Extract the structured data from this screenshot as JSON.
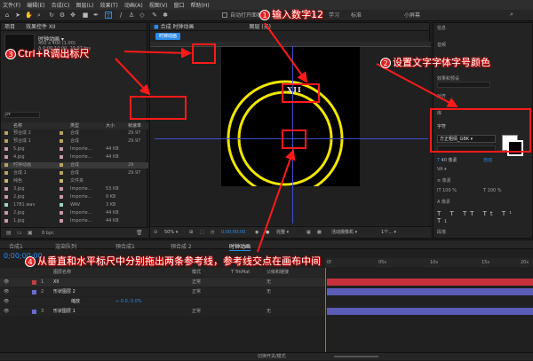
{
  "menu": [
    "文件(F)",
    "编辑(E)",
    "合成(C)",
    "图层(L)",
    "效果(T)",
    "动画(A)",
    "视图(V)",
    "窗口",
    "帮助(H)"
  ],
  "toolbar": {
    "auto_open_panel": "自动打开面板",
    "default": "默认",
    "learn": "学习",
    "standard": "标准",
    "small_screen": "小屏幕"
  },
  "project": {
    "tab_label": "项目",
    "tab_effects": "效果控件 XII",
    "comp_name": "时钟动画 ▾",
    "comp_size": "400 x 400 (1.00)",
    "comp_duration": "Δ 0;00;10;00, 29.97 fps",
    "search_placeholder": "ρ▾",
    "headers": {
      "name": "名称",
      "type": "类型",
      "size": "大小",
      "fps": "帧速率"
    },
    "rows": [
      {
        "name": "预合成 2",
        "type": "合成",
        "size": "",
        "fps": "29.97",
        "color": "#b9a35b"
      },
      {
        "name": "预合成 1",
        "type": "合成",
        "size": "",
        "fps": "29.97",
        "color": "#b9a35b"
      },
      {
        "name": "5.jpg",
        "type": "Importe...",
        "size": "44 KB",
        "fps": "",
        "color": "#c79aa5"
      },
      {
        "name": "4.jpg",
        "type": "Importe...",
        "size": "44 KB",
        "fps": "",
        "color": "#c79aa5"
      },
      {
        "name": "时钟动画",
        "type": "合成",
        "size": "",
        "fps": "29",
        "color": "#b9a35b"
      },
      {
        "name": "合成 1",
        "type": "合成",
        "size": "",
        "fps": "29.97",
        "color": "#b9a35b"
      },
      {
        "name": "纯色",
        "type": "文件夹",
        "size": "",
        "fps": "",
        "color": "#c9b46a"
      },
      {
        "name": "3.jpg",
        "type": "Importe...",
        "size": "53 KB",
        "fps": "",
        "color": "#c79aa5"
      },
      {
        "name": "2.jpg",
        "type": "Importe...",
        "size": "9 KB",
        "fps": "",
        "color": "#c79aa5"
      },
      {
        "name": "1781.wav",
        "type": "WAV",
        "size": "3 KB",
        "fps": "",
        "color": "#9fd3c7"
      },
      {
        "name": "2.jpg",
        "type": "Importe...",
        "size": "44 KB",
        "fps": "",
        "color": "#c79aa5"
      },
      {
        "name": "1.jpg",
        "type": "Importe...",
        "size": "44 KB",
        "fps": "",
        "color": "#c79aa5"
      }
    ],
    "bpc": "8 bpc"
  },
  "comp": {
    "tab_label": "合成 时钟动画",
    "tab_active": "时钟动画",
    "layer_label": "图层 (无)",
    "canvas_text": "XII",
    "bottom": {
      "zoom": "50%",
      "timecode": "0;00;00;00",
      "quality": "完整",
      "camera": "活动摄像机",
      "views": "1个..."
    }
  },
  "right_panel": {
    "info": "信息",
    "audio": "音频",
    "preview": "预览",
    "effects": "效果和预设",
    "align": "对齐",
    "library": "库",
    "character": "字符",
    "font": "方正粗倩_GBK",
    "pixel_size": "40 像素",
    "auto": "自动",
    "px_label": "像素",
    "pct": "100 %",
    "pct2": "100 %",
    "paragraph": "段落"
  },
  "timeline": {
    "tabs": [
      "合成1",
      "渲染队列",
      "预合成1",
      "预合成 2",
      "时钟动画"
    ],
    "timecode": "0;00;00;00",
    "headers": {
      "layer_name": "图层名称",
      "mode": "模式",
      "trkmat": "T TrkMat",
      "parent": "父级和链接"
    },
    "layers": [
      {
        "index": "1",
        "name": "XII",
        "mode": "正常",
        "parent": "无",
        "label": "#c04040",
        "bar": "#c8323c"
      },
      {
        "index": "2",
        "name": "形状图层 2",
        "mode": "正常",
        "parent": "无",
        "label": "#6a6ad2",
        "bar": "#5b5bb8"
      },
      {
        "index": "",
        "name": "缩放",
        "mode": "",
        "parent": "",
        "label": "",
        "bar": ""
      },
      {
        "index": "3",
        "name": "形状图层 1",
        "mode": "正常",
        "parent": "无",
        "label": "#6a6ad2",
        "bar": "#5b5bb8"
      }
    ],
    "scale_value": "∞ 0.0, 0.0%",
    "ruler": [
      "0f",
      "05s",
      "10s",
      "15s",
      "20s"
    ],
    "toggle": "切换开关/模式"
  },
  "annotations": {
    "step1": {
      "num": "1",
      "text": "输入数字12"
    },
    "step2": {
      "num": "2",
      "text": "设置文字字体字号颜色"
    },
    "step3": {
      "num": "3",
      "text": "Ctrl+R调出标尺"
    },
    "step4": {
      "num": "4",
      "text": "从垂直和水平标尺中分别拖出两条参考线，参考线交点在画布中间"
    }
  },
  "colors": {
    "accent": "#2d8ceb",
    "ring": "#f2e600",
    "guide": "#3d4fd0",
    "annotation": "#ff1a1a"
  }
}
